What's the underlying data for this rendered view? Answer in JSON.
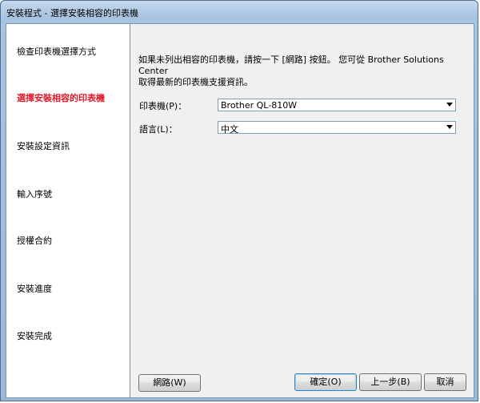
{
  "window": {
    "title": "安裝程式 - 選擇安裝相容的印表機"
  },
  "sidebar": {
    "items": [
      {
        "label": "檢查印表機選擇方式",
        "active": false
      },
      {
        "label": "選擇安裝相容的印表機",
        "active": true
      },
      {
        "label": "安裝設定資訊",
        "active": false
      },
      {
        "label": "輸入序號",
        "active": false
      },
      {
        "label": "授權合約",
        "active": false
      },
      {
        "label": "安裝進度",
        "active": false
      },
      {
        "label": "安裝完成",
        "active": false
      }
    ]
  },
  "main": {
    "description_line1": "如果未列出相容的印表機，請按一下 [網路] 按鈕。 您可從 Brother Solutions Center",
    "description_line2": "取得最新的印表機支援資訊。",
    "printer_label": "印表機(P)：",
    "printer_value": "Brother QL-810W",
    "language_label": "語言(L)：",
    "language_value": "中文"
  },
  "buttons": {
    "network": "網路(W)",
    "ok": "確定(O)",
    "back": "上一步(B)",
    "cancel": "取消"
  },
  "colors": {
    "active_step": "#e0182a",
    "title_bar": "#a9c4e1",
    "panel_bg": "#f0f0f0"
  }
}
